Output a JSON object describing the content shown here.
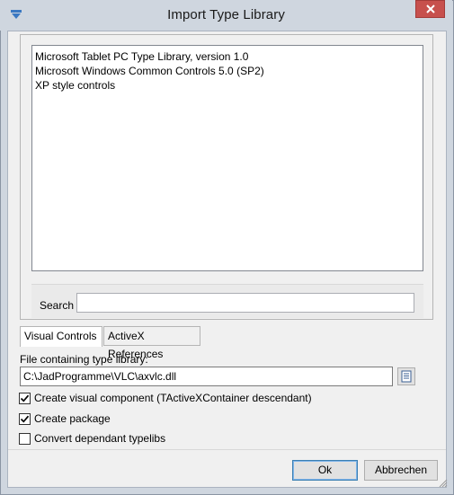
{
  "window": {
    "title": "Import Type Library"
  },
  "list": {
    "items": [
      "Microsoft Tablet PC Type Library, version 1.0",
      "Microsoft Windows Common Controls 5.0 (SP2)",
      "XP style controls"
    ]
  },
  "search": {
    "label": "Search",
    "value": ""
  },
  "tabs": [
    {
      "label": "Visual Controls",
      "active": true
    },
    {
      "label": "ActiveX References",
      "active": false
    }
  ],
  "file": {
    "label": "File containing type library:",
    "value": "C:\\JadProgramme\\VLC\\axvlc.dll"
  },
  "options": [
    {
      "label": "Create visual component (TActiveXContainer descendant)",
      "checked": true
    },
    {
      "label": "Create package",
      "checked": true
    },
    {
      "label": "Convert dependant typelibs",
      "checked": false
    }
  ],
  "buttons": {
    "ok": "Ok",
    "cancel": "Abbrechen"
  },
  "colors": {
    "titlebar": "#cfd6df",
    "close": "#c7504d",
    "client": "#f0f0f0"
  }
}
